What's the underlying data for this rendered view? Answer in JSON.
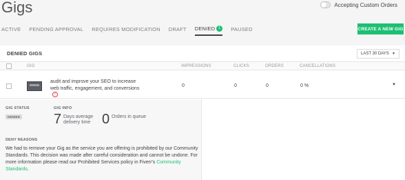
{
  "page": {
    "title": "Gigs"
  },
  "toggle": {
    "label": "Accepting Custom Orders",
    "on": false
  },
  "tabs": [
    {
      "label": "ACTIVE"
    },
    {
      "label": "PENDING APPROVAL"
    },
    {
      "label": "REQUIRES MODIFICATION"
    },
    {
      "label": "DRAFT"
    },
    {
      "label": "DENIED",
      "count": "1",
      "active": true
    },
    {
      "label": "PAUSED"
    }
  ],
  "create_button": "CREATE A NEW GIG",
  "panel": {
    "title": "DENIED GIGS",
    "date_range": "LAST 30 DAYS"
  },
  "table": {
    "columns": [
      "GIG",
      "IMPRESSIONS",
      "CLICKS",
      "ORDERS",
      "CANCELLATIONS"
    ],
    "rows": [
      {
        "title": "audit and improve your SEO to increase web traffic, engagement, and conversions",
        "impressions": "0",
        "clicks": "0",
        "orders": "0",
        "cancellations": "0 %"
      }
    ]
  },
  "details": {
    "status_label": "GIG STATUS",
    "status_value": "DENIED",
    "info_label": "GIG INFO",
    "delivery_number": "7",
    "delivery_caption": "Days average delivery time",
    "queue_number": "0",
    "queue_caption": "Orders in queue",
    "deny_label": "DENY REASONS",
    "deny_text": "We had to remove your Gig as the service you are offering is prohibited by our Community Standards. This decision was made after careful consideration and cannot be undone. For more information please read our Prohibited Services policy in Fiverr's",
    "deny_link": "Community Standards",
    "deny_end": "."
  },
  "colors": {
    "accent": "#1dbf73",
    "warning": "#e0393e"
  }
}
